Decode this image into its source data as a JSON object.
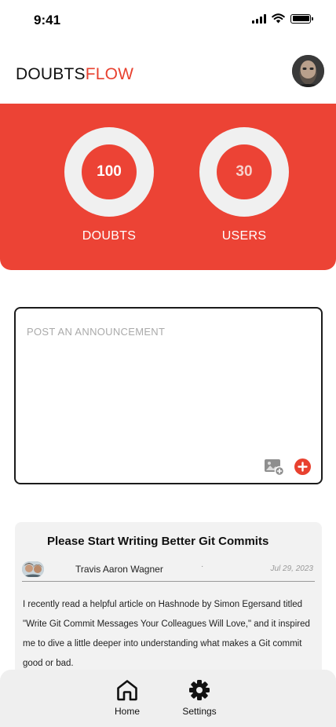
{
  "status_bar": {
    "time": "9:41"
  },
  "header": {
    "logo_part1": "DOUBTS",
    "logo_part2": "FLOW"
  },
  "stats": [
    {
      "value": "100",
      "label": "DOUBTS",
      "value_color": "#ffffff"
    },
    {
      "value": "30",
      "label": "USERS",
      "value_color": "#f6d2cc"
    }
  ],
  "composer": {
    "placeholder": "POST AN ANNOUNCEMENT",
    "image_icon": "add-image-icon",
    "add_icon": "plus-circle-icon"
  },
  "post": {
    "title": "Please Start Writing Better Git Commits",
    "author": "Travis Aaron Wagner",
    "separator": "·",
    "date": "Jul 29, 2023",
    "body": "I recently read a helpful article on Hashnode by Simon Egersand titled \"Write Git Commit Messages Your Colleagues Will Love,\" and it inspired me to dive a little deeper into understanding what makes a Git commit good or bad."
  },
  "nav": [
    {
      "label": "Home",
      "icon": "home-icon"
    },
    {
      "label": "Settings",
      "icon": "gear-icon"
    }
  ],
  "colors": {
    "accent": "#ec4335",
    "ring": "#f0f0f0",
    "nav_bg": "#efefef",
    "card_bg": "#f2f2f2"
  }
}
